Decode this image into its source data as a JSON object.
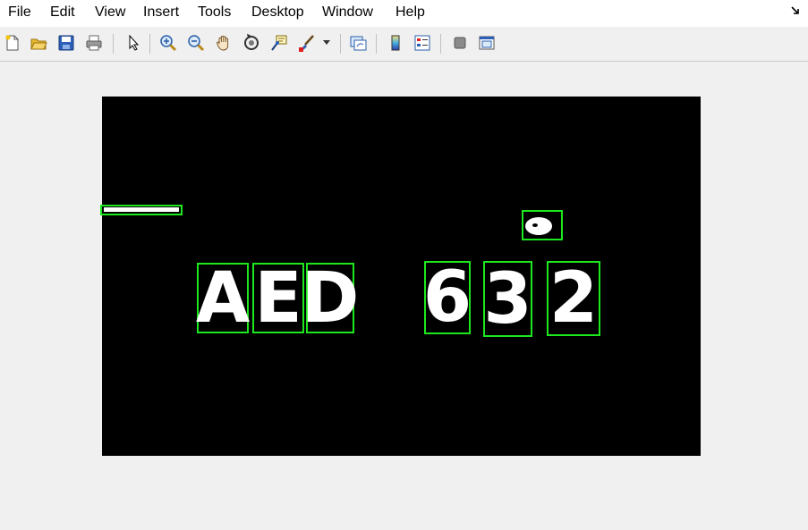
{
  "menubar": {
    "items": [
      {
        "label": "File"
      },
      {
        "label": "Edit"
      },
      {
        "label": "View"
      },
      {
        "label": "Insert"
      },
      {
        "label": "Tools"
      },
      {
        "label": "Desktop"
      },
      {
        "label": "Window"
      },
      {
        "label": "Help"
      }
    ]
  },
  "toolbar": {
    "buttons": [
      {
        "icon": "new-figure-icon"
      },
      {
        "icon": "open-file-icon"
      },
      {
        "icon": "save-icon"
      },
      {
        "icon": "print-icon"
      },
      {
        "icon": "edit-plot-arrow-icon"
      },
      {
        "icon": "zoom-in-icon"
      },
      {
        "icon": "zoom-out-icon"
      },
      {
        "icon": "pan-hand-icon"
      },
      {
        "icon": "rotate-3d-icon"
      },
      {
        "icon": "data-cursor-icon"
      },
      {
        "icon": "brush-icon"
      },
      {
        "icon": "link-plot-icon"
      },
      {
        "icon": "insert-colorbar-icon"
      },
      {
        "icon": "insert-legend-icon"
      },
      {
        "icon": "hide-plot-tools-icon"
      },
      {
        "icon": "show-plot-tools-icon"
      }
    ]
  },
  "figure": {
    "image_background": "#000000",
    "box_color": "#1de81d",
    "characters": [
      "A",
      "E",
      "D",
      "6",
      "3",
      "2"
    ]
  }
}
